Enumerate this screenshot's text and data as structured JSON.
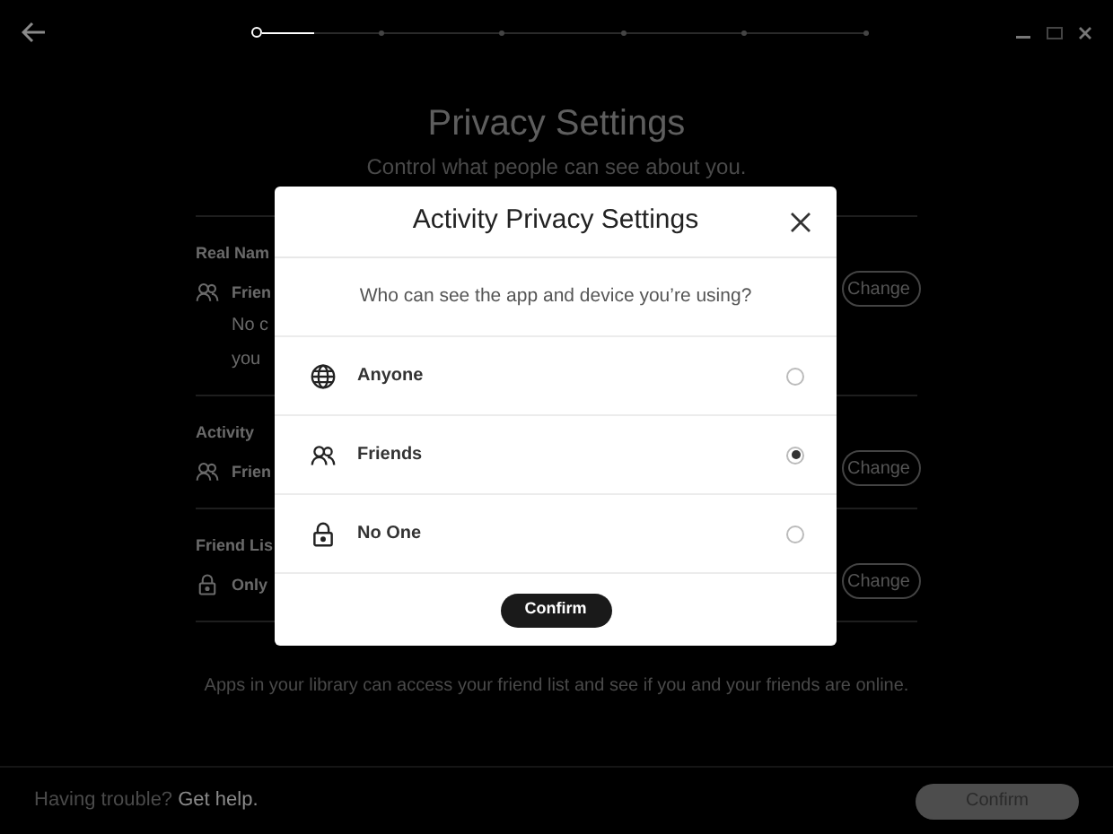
{
  "stepper": [
    {
      "selected": true
    },
    {
      "selected": false
    },
    {
      "selected": false
    },
    {
      "selected": false
    },
    {
      "selected": false
    },
    {
      "selected": false
    }
  ],
  "page": {
    "title": "Privacy Settings",
    "subtitle": "Control what people can see about you.",
    "sections": [
      {
        "label": "Real Nam",
        "value": "Frien",
        "kind": "friends",
        "description": [
          "No c",
          "you"
        ],
        "button": "Change"
      },
      {
        "label": "Activity",
        "value": "Frien",
        "kind": "friends",
        "button": "Change"
      },
      {
        "label": "Friend Lis",
        "value": "Only",
        "kind": "lock",
        "button": "Change"
      }
    ],
    "note": "Apps in your library can access your friend list and see if you and your friends are online."
  },
  "footer": {
    "help_prefix": "Having trouble?",
    "help_link": "Get help.",
    "confirm": {
      "label": "Confirm",
      "disabled": true
    }
  },
  "dialog": {
    "title": "Activity Privacy Settings",
    "question": "Who can see the app and device you’re using?",
    "options": [
      {
        "label": "Anyone",
        "kind": "globe",
        "selected": false
      },
      {
        "label": "Friends",
        "kind": "friends",
        "selected": true
      },
      {
        "label": "No One",
        "kind": "lock",
        "selected": false
      }
    ],
    "confirm": "Confirm"
  }
}
